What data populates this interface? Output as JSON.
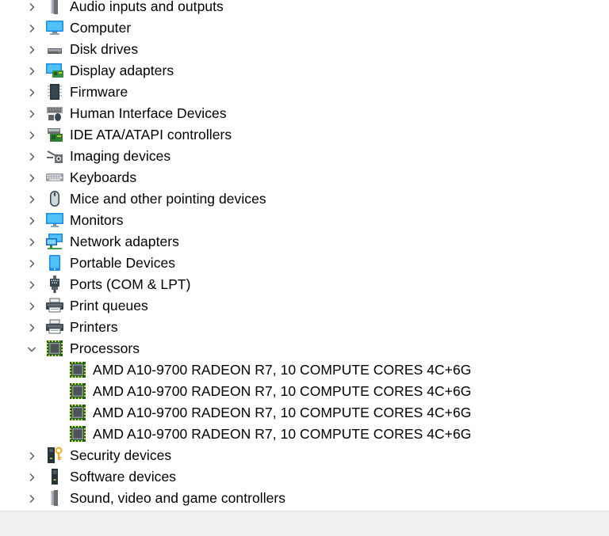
{
  "tree": {
    "items": [
      {
        "label": "Audio inputs and outputs",
        "icon": "speaker-icon",
        "expanded": false
      },
      {
        "label": "Computer",
        "icon": "computer-icon",
        "expanded": false
      },
      {
        "label": "Disk drives",
        "icon": "disk-drive-icon",
        "expanded": false
      },
      {
        "label": "Display adapters",
        "icon": "display-adapter-icon",
        "expanded": false
      },
      {
        "label": "Firmware",
        "icon": "firmware-icon",
        "expanded": false
      },
      {
        "label": "Human Interface Devices",
        "icon": "hid-icon",
        "expanded": false
      },
      {
        "label": "IDE ATA/ATAPI controllers",
        "icon": "ide-controller-icon",
        "expanded": false
      },
      {
        "label": "Imaging devices",
        "icon": "camera-icon",
        "expanded": false
      },
      {
        "label": "Keyboards",
        "icon": "keyboard-icon",
        "expanded": false
      },
      {
        "label": "Mice and other pointing devices",
        "icon": "mouse-icon",
        "expanded": false
      },
      {
        "label": "Monitors",
        "icon": "monitor-icon",
        "expanded": false
      },
      {
        "label": "Network adapters",
        "icon": "network-adapter-icon",
        "expanded": false
      },
      {
        "label": "Portable Devices",
        "icon": "portable-device-icon",
        "expanded": false
      },
      {
        "label": "Ports (COM & LPT)",
        "icon": "port-icon",
        "expanded": false
      },
      {
        "label": "Print queues",
        "icon": "printer-icon",
        "expanded": false
      },
      {
        "label": "Printers",
        "icon": "printer-icon",
        "expanded": false
      },
      {
        "label": "Processors",
        "icon": "processor-icon",
        "expanded": true,
        "children": [
          {
            "label": "AMD A10-9700 RADEON R7, 10 COMPUTE CORES 4C+6G",
            "icon": "processor-icon"
          },
          {
            "label": "AMD A10-9700 RADEON R7, 10 COMPUTE CORES 4C+6G",
            "icon": "processor-icon"
          },
          {
            "label": "AMD A10-9700 RADEON R7, 10 COMPUTE CORES 4C+6G",
            "icon": "processor-icon"
          },
          {
            "label": "AMD A10-9700 RADEON R7, 10 COMPUTE CORES 4C+6G",
            "icon": "processor-icon"
          }
        ]
      },
      {
        "label": "Security devices",
        "icon": "security-device-icon",
        "expanded": false
      },
      {
        "label": "Software devices",
        "icon": "software-device-icon",
        "expanded": false
      },
      {
        "label": "Sound, video and game controllers",
        "icon": "speaker-icon",
        "expanded": false
      }
    ]
  },
  "colors": {
    "chevron": "#555555",
    "statusbar": "#f0f0f0",
    "chip_green": "#2e7d32"
  }
}
